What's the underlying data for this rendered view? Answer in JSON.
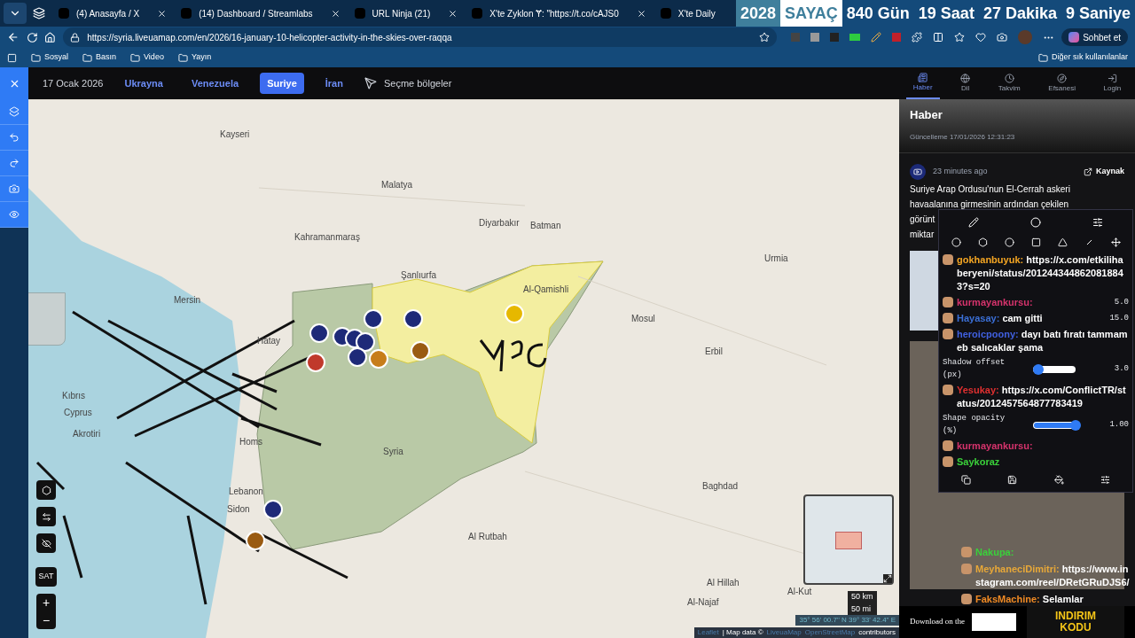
{
  "browser": {
    "tabs": [
      {
        "title": "(4) Anasayfa / X",
        "selected": false
      },
      {
        "title": "(14) Dashboard / Streamlabs",
        "selected": false
      },
      {
        "title": "URL Ninja (21)",
        "selected": false
      },
      {
        "title": "X'te Zyklon Ɏ: \"https://t.co/cAJS0",
        "selected": false
      },
      {
        "title": "X'te Daily",
        "selected": false
      }
    ],
    "countdown": [
      {
        "text": "2028",
        "kind": "year"
      },
      {
        "text": "SAYAÇ",
        "kind": "title"
      },
      {
        "text": "840 Gün",
        "kind": "unit"
      },
      {
        "text": "19 Saat",
        "kind": "unit"
      },
      {
        "text": "27 Dakika",
        "kind": "unit"
      },
      {
        "text": "9 Saniye",
        "kind": "unit"
      }
    ],
    "url": "https://syria.liveuamap.com/en/2026/16-january-10-helicopter-activity-in-the-skies-over-raqqa",
    "chat_button": "Sohbet et",
    "bookmarks": [
      "Sosyal",
      "Basın",
      "Video",
      "Yayın"
    ],
    "other_bookmarks": "Diğer sık kullanılanlar"
  },
  "map_header": {
    "date": "17 Ocak 2026",
    "regions": [
      {
        "label": "Ukrayna",
        "selected": false
      },
      {
        "label": "Venezuela",
        "selected": false
      },
      {
        "label": "Suriye",
        "selected": true
      },
      {
        "label": "İran",
        "selected": false
      }
    ],
    "select_regions": "Seçme bölgeler"
  },
  "map": {
    "labels": [
      "Kayseri",
      "Malatya",
      "Kahramanmaraş",
      "Diyarbakır",
      "Batman",
      "Şanlıurfa",
      "Mersin",
      "Hatay",
      "Al-Qamishli",
      "Mosul",
      "Erbil",
      "Urmia",
      "Syria",
      "Homs",
      "Lebanon",
      "Kıbrıs",
      "Cyprus",
      "Akrotiri",
      "Sidon",
      "Al Rutbah",
      "Baghdad",
      "Al Hillah",
      "Al-Kut",
      "Al-Najaf"
    ],
    "markers": [
      {
        "color": "#1e2a78"
      },
      {
        "color": "#1e2a78"
      },
      {
        "color": "#1e2a78"
      },
      {
        "color": "#1e2a78"
      },
      {
        "color": "#1e2a78"
      },
      {
        "color": "#1e2a78"
      },
      {
        "color": "#c0392b"
      },
      {
        "color": "#1e2a78"
      },
      {
        "color": "#c77d1a"
      },
      {
        "color": "#9a5b12"
      },
      {
        "color": "#e6b800"
      },
      {
        "color": "#1e2a78"
      },
      {
        "color": "#9a5b12"
      }
    ],
    "map_mode": "SAT",
    "zoom_in": "+",
    "zoom_out": "−",
    "scale_km": "50 km",
    "scale_mi": "50 mi",
    "coordinates": "35° 56' 00.7\" N 39° 33' 42.4\" E",
    "attribution": [
      {
        "text": "Leaflet",
        "kind": "link"
      },
      {
        "text": "| Map data ©",
        "kind": "text"
      },
      {
        "text": "LiveuaMap",
        "kind": "link"
      },
      {
        "text": "OpenStreetMap",
        "kind": "link"
      },
      {
        "text": "contributors",
        "kind": "text"
      }
    ]
  },
  "sidebar": {
    "nav": [
      {
        "label": "Haber",
        "selected": true
      },
      {
        "label": "Dil",
        "selected": false
      },
      {
        "label": "Takvim",
        "selected": false
      },
      {
        "label": "Efsanesi",
        "selected": false
      },
      {
        "label": "Login",
        "selected": false
      }
    ],
    "title": "Haber",
    "updated": "Güncelleme 17/01/2026 12:31:23",
    "news_time": "23 minutes ago",
    "source": "Kaynak",
    "news_lines": [
      "Suriye Arap Ordusu'nun El-Cerrah askeri",
      "havaalanına girmesinin ardından çekilen",
      "görünt",
      "miktar"
    ],
    "download": "Download on the",
    "ad": [
      "INDIRIM",
      "KODU"
    ]
  },
  "chat": [
    {
      "kind": "message",
      "user": "gokhanbuyuk:",
      "color": "#f5a623",
      "text": "https://x.com/etkilihaberyeni/status/2012443448620818843?s=20"
    },
    {
      "kind": "message",
      "user": "kurmayankursu:",
      "color": "#d6336c",
      "value": "5.0"
    },
    {
      "kind": "message",
      "user": "Hayasay:",
      "color": "#3b6fd6",
      "text": "cam gitti",
      "value": "15.0"
    },
    {
      "kind": "message",
      "user": "heroicpoony:",
      "color": "#4060e0",
      "text": "dayı batı fıratı tammameb salıcaklar şama"
    },
    {
      "kind": "slider",
      "label": "Shadow offset (px)",
      "value": "3.0",
      "level": 0.12
    },
    {
      "kind": "message",
      "user": "Yesukay:",
      "color": "#e03030",
      "text": "https://x.com/ConflictTR/status/2012457564877783419"
    },
    {
      "kind": "slider",
      "label": "Shape opacity (%)",
      "value": "1.00",
      "level": 1
    },
    {
      "kind": "message",
      "user": "kurmayankursu:",
      "color": "#d6336c"
    },
    {
      "kind": "message",
      "user": "Saykoraz",
      "color": "#3ad13a"
    },
    {
      "kind": "message",
      "user": "Nakupa:",
      "color": "#3ad13a"
    },
    {
      "kind": "message",
      "user": "MeyhaneciDimitri:",
      "color": "#e8a838",
      "text": "https://www.instagram.com/reel/DRetGRuDJS6/"
    },
    {
      "kind": "message",
      "user": "FaksMachine:",
      "color": "#f08a24",
      "text": "Selamlar"
    }
  ]
}
